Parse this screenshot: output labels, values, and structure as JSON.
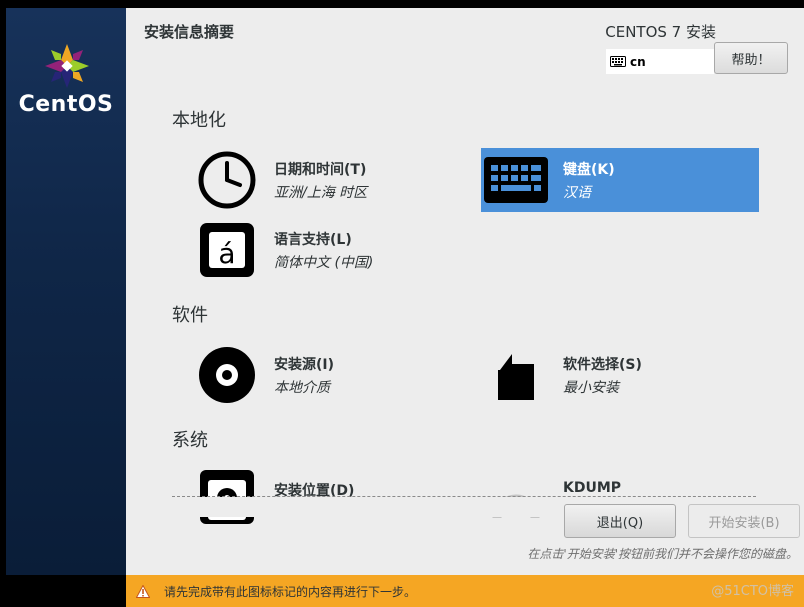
{
  "sidebar": {
    "brand": "CentOS"
  },
  "header": {
    "title": "安装信息摘要",
    "product": "CENTOS 7 安装",
    "keyboard_layout": "cn",
    "help_label": "帮助！"
  },
  "sections": [
    {
      "label": "本地化"
    },
    {
      "label": "软件"
    },
    {
      "label": "系统"
    }
  ],
  "spokes": {
    "datetime": {
      "title": "日期和时间(T)",
      "subtitle": "亚洲/上海 时区"
    },
    "keyboard": {
      "title": "键盘(K)",
      "subtitle": "汉语"
    },
    "language": {
      "title": "语言支持(L)",
      "subtitle": "简体中文 (中国)"
    },
    "source": {
      "title": "安装源(I)",
      "subtitle": "本地介质"
    },
    "software": {
      "title": "软件选择(S)",
      "subtitle": "最小安装"
    },
    "destination": {
      "title": "安装位置(D)"
    },
    "kdump": {
      "title": "KDUMP"
    }
  },
  "buttons": {
    "quit": "退出(Q)",
    "begin": "开始安装(B)"
  },
  "footnote": "在点击'开始安装'按钮前我们并不会操作您的磁盘。",
  "warning": "请先完成带有此图标标记的内容再进行下一步。",
  "watermark": "@51CTO博客",
  "colors": {
    "selected": "#4a90d9",
    "warning_bar": "#f5a623",
    "sidebar": "#17325a"
  }
}
